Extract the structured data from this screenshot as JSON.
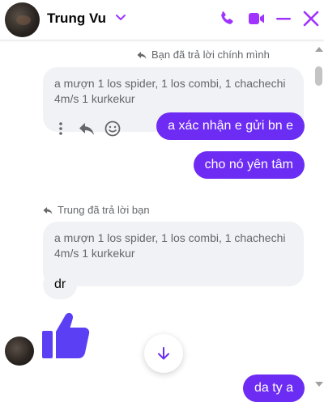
{
  "header": {
    "contact_name": "Trung Vu",
    "accent_color": "#a033ff"
  },
  "messages": {
    "reply_note_1": "Bạn đã trả lời chính mình",
    "quoted_1": "a mượn 1 los spider, 1 los combi, 1 chachechi 4m/s 1 kurkekur",
    "out_1": "a xác nhận e gửi bn e",
    "out_2": "cho nó yên tâm",
    "reply_note_2": "Trung đã trả lời bạn",
    "quoted_2": "a mượn 1 los spider, 1 los combi, 1 chachechi 4m/s 1 kurkekur",
    "in_1": "dr",
    "out_3": "da ty a"
  },
  "icons": {
    "header": [
      "chevron-down-icon",
      "phone-icon",
      "video-icon",
      "minimize-icon",
      "close-icon"
    ],
    "message_tools": [
      "more-icon",
      "reply-icon",
      "emoji-icon"
    ],
    "reaction": "thumbs-up-icon",
    "scroll": "arrow-down-icon"
  },
  "colors": {
    "outgoing_bubble": "#6b2ef4",
    "incoming_bubble": "#f0f2f5",
    "thumb_up": "#5b3ff5"
  }
}
